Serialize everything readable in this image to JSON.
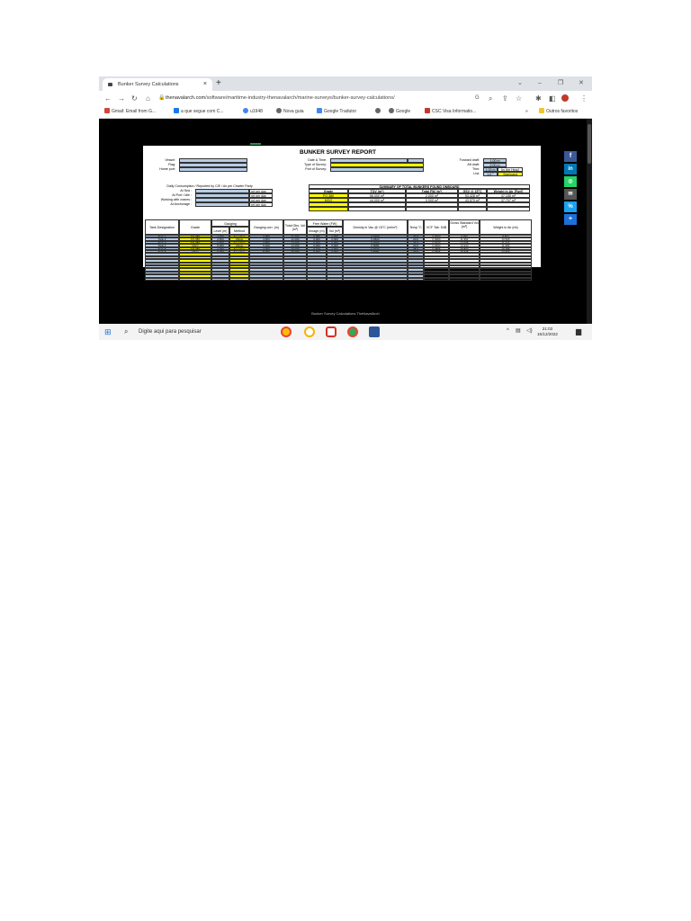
{
  "browser": {
    "tab_title": "Bunker Survey Calculations",
    "tab_close": "×",
    "new_tab": "+",
    "url_domain": "thenavalarch.com",
    "url_path": "/software/maritime-industry-thenavalarch/marine-surveys/bunker-survey-calculations/",
    "bookmarks": [
      "Gmail: Email from G...",
      "a que segue com C...",
      "u1948",
      "Nova guia",
      "Google Tradutor",
      "Google",
      "CSC Visa Informatio...",
      "»",
      "Outros favoritos"
    ]
  },
  "report": {
    "title": "BUNKER SURVEY REPORT",
    "labels": {
      "vessel": "Vessel:",
      "flag": "Flag:",
      "home_port": "Home port:",
      "date_time": "Date & Time:",
      "type_of_survey": "Type of Survey:",
      "port_of_survey": "Port of Survey:",
      "forward_draft": "Forward draft:",
      "aft_draft": "Aft draft:",
      "trim": "Trim:",
      "list": "List:"
    },
    "values": {
      "forward_draft": "1.00 m",
      "aft_draft": "2.00 m",
      "trim": "1.00 m",
      "trim_note": "by the Head",
      "list": "1.0 °",
      "list_side": "Starboard"
    },
    "consumption": {
      "heading": "Daily Consumption / Reported by C/E / As per Charter Party",
      "rows": [
        {
          "label": "At Sea :",
          "unit": "mt per day"
        },
        {
          "label": "At Port / Idle :",
          "unit": "mt per day"
        },
        {
          "label": "Working with cranes :",
          "unit": "mt per day"
        },
        {
          "label": "At Anchorage :",
          "unit": "mt per day"
        }
      ]
    },
    "summary": {
      "heading": "SUMMARY OF TOTAL BUNKERS FOUND ONBOARD",
      "columns": [
        "Grade",
        "TOV (m³)",
        "Total FW (m³)",
        "GSV @ 15°C",
        "Weight in Air [Fuel]"
      ],
      "rows": [
        [
          "FO 380",
          "56.000 m³",
          "2.000 m³",
          "53.428 m³",
          "47.155 m³"
        ],
        [
          "MGO",
          "44.000 m³",
          "0.000 m³",
          "43.579 m³",
          "37.707 m³"
        ]
      ]
    },
    "tanks": {
      "headers": {
        "designation": "Tank Designation",
        "grade": "Grade",
        "gauging": "Gauging",
        "level": "Level (m)",
        "method": "Method",
        "gauging_corr": "Gauging corr. (m)",
        "total_obs_vol": "Total Obs. Vol (m³)",
        "free_water": "Free Water (FW)",
        "fw_innage": "Innage (m)",
        "fw_vol": "Vol (m³)",
        "density": "Density in Vac @ 15°C (mt/m³)",
        "temp": "Temp °C",
        "vcf": "VCF Tab. 54B",
        "gsv": "Gross Standard Vol (m³)",
        "weight": "Weight in Air (mt)"
      },
      "rows": [
        [
          "Tank 1",
          "FO 380",
          "4.000",
          "Sounding",
          "3.950",
          "11.000",
          "0.050",
          "1.000",
          "0.9700",
          "20.0",
          "0.9960",
          "9.960",
          "8.834"
        ],
        [
          "Tank 2",
          "FO 380",
          "4.500",
          "Ullage",
          "4.500",
          "12.000",
          "0.000",
          "0.000",
          "0.9820",
          "20.0",
          "0.9960",
          "11.952",
          "10.529"
        ],
        [
          "Tank 3",
          "FO 380",
          "4.600",
          "Sounding",
          "4.550",
          "13.000",
          "0.000",
          "0.000",
          "0.9700",
          "24.0",
          "0.9927",
          "12.905",
          "11.214"
        ],
        [
          "Tank 4",
          "MGO",
          "5.000",
          "Ullage",
          "5.020",
          "14.000",
          "0.000",
          "0.000",
          "0.8081",
          "20.0",
          "0.9960",
          "13.943",
          "11.080"
        ],
        [
          "Tank 5",
          "FO 380",
          "2.000",
          "Sounding",
          "2.900",
          "20.000",
          "0.100",
          "1.000",
          "0.9020",
          "28.0",
          "0.9896",
          "18.807",
          "16.755"
        ],
        [
          "Tank 6",
          "MGO",
          "6.000",
          "Sounding",
          "5.900",
          "30.000",
          "0.000",
          "0.000",
          "0.8081",
          "30.0",
          "0.9876",
          "29.635",
          "23.697"
        ]
      ]
    }
  },
  "caption": "Bunker Survey Calculations TheNavalArch",
  "side_share": [
    "f",
    "in",
    "◎",
    "✉",
    "%",
    "+"
  ],
  "taskbar": {
    "search_placeholder": "Digite aqui para pesquisar",
    "time": "21:02",
    "date": "15/12/2022"
  },
  "colors": {
    "cell_blue": "#b8cce4",
    "cell_yellow": "#ffff00"
  }
}
